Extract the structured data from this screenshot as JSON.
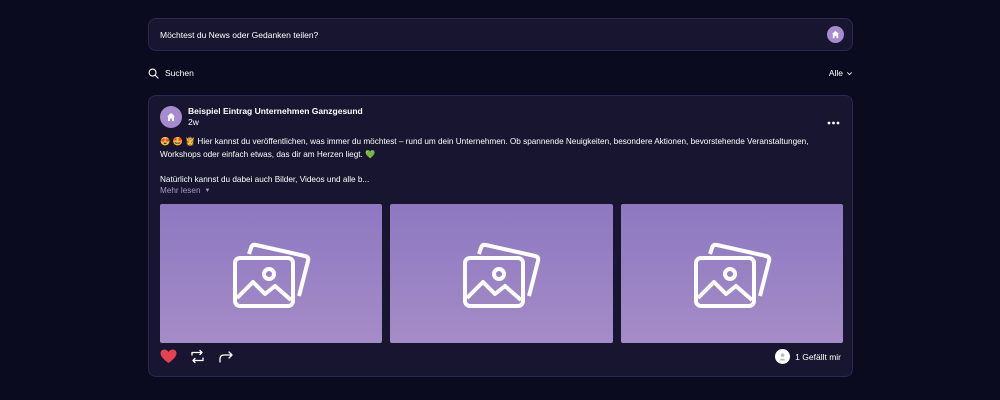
{
  "composer": {
    "placeholder": "Möchtest du News oder Gedanken teilen?",
    "avatar_icon": "home-icon"
  },
  "filter_bar": {
    "search_label": "Suchen",
    "filter_label": "Alle"
  },
  "post": {
    "author": "Beispiel Eintrag Unternehmen Ganzgesund",
    "time": "2w",
    "body_line1": "😍 🤩 👸 Hier kannst du veröffentlichen, was immer du möchtest – rund um dein Unternehmen. Ob spannende Neuigkeiten, besondere Aktionen, bevorstehende Veranstaltungen,",
    "body_line2": "Workshops oder einfach etwas, das dir am Herzen liegt. 💚",
    "body_line3": "Natürlich kannst du dabei auch Bilder, Videos und alle b...",
    "read_more": "Mehr lesen",
    "read_more_dot": "▼",
    "images": [
      {
        "icon": "image-placeholder-icon"
      },
      {
        "icon": "image-placeholder-icon"
      },
      {
        "icon": "image-placeholder-icon"
      }
    ],
    "likes_text": "1 Gefällt mir",
    "colors": {
      "heart": "#e8414f",
      "accent": "#a68bcf"
    }
  }
}
